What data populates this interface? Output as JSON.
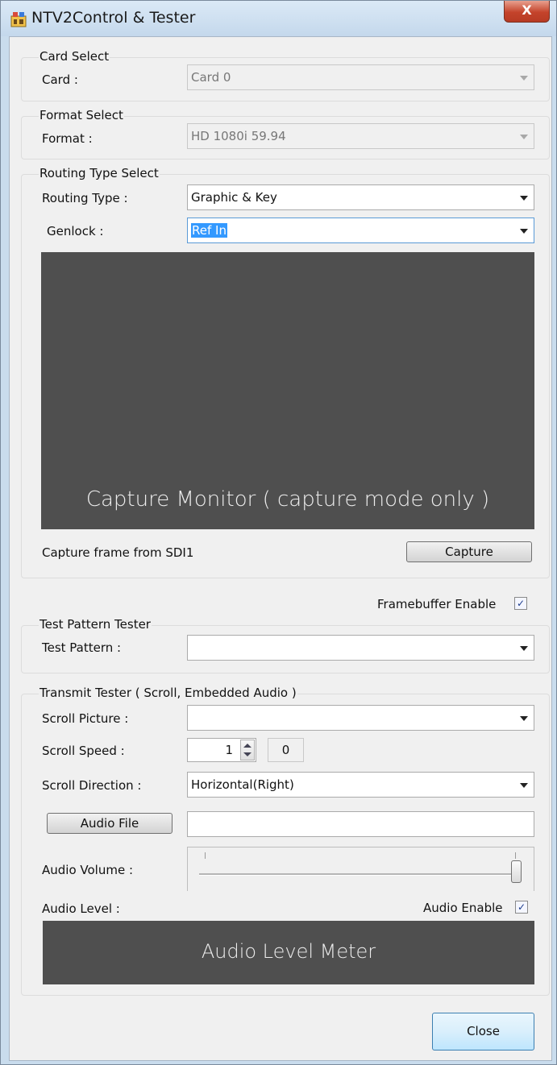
{
  "window": {
    "title": "NTV2Control & Tester",
    "close_glyph": "X",
    "app_icon": "app-icon"
  },
  "card_select": {
    "group_title": "Card Select",
    "card_label": "Card :",
    "card_value": "Card 0"
  },
  "format_select": {
    "group_title": "Format Select",
    "format_label": "Format :",
    "format_value": "HD 1080i 59.94"
  },
  "routing_select": {
    "group_title": "Routing Type Select",
    "routing_label": "Routing Type :",
    "routing_value": "Graphic & Key",
    "genlock_label": "Genlock :",
    "genlock_value": "Ref In",
    "capture_monitor_text": "Capture Monitor ( capture mode only )",
    "capture_frame_label": "Capture frame from SDI1",
    "capture_button": "Capture"
  },
  "framebuffer": {
    "label": "Framebuffer Enable",
    "checked": true,
    "check_glyph": "✓"
  },
  "test_pattern": {
    "group_title": "Test Pattern Tester",
    "pattern_label": "Test Pattern :",
    "pattern_value": ""
  },
  "transmit": {
    "group_title": "Transmit Tester ( Scroll, Embedded Audio )",
    "scroll_picture_label": "Scroll Picture :",
    "scroll_picture_value": "",
    "scroll_speed_label": "Scroll Speed :",
    "scroll_speed_value": "1",
    "scroll_speed_readout": "0",
    "scroll_direction_label": "Scroll Direction :",
    "scroll_direction_value": "Horizontal(Right)",
    "audio_file_button": "Audio File",
    "audio_file_path": "",
    "audio_volume_label": "Audio Volume :",
    "audio_volume_level": 1.0,
    "audio_level_label": "Audio Level :",
    "audio_enable_label": "Audio Enable",
    "audio_enable_checked": true,
    "audio_meter_text": "Audio Level Meter"
  },
  "footer": {
    "close_button": "Close"
  },
  "colors": {
    "accent_selection": "#3399ff",
    "monitor_bg": "#4f4f4f",
    "close_button_border": "#3c7fb1"
  }
}
